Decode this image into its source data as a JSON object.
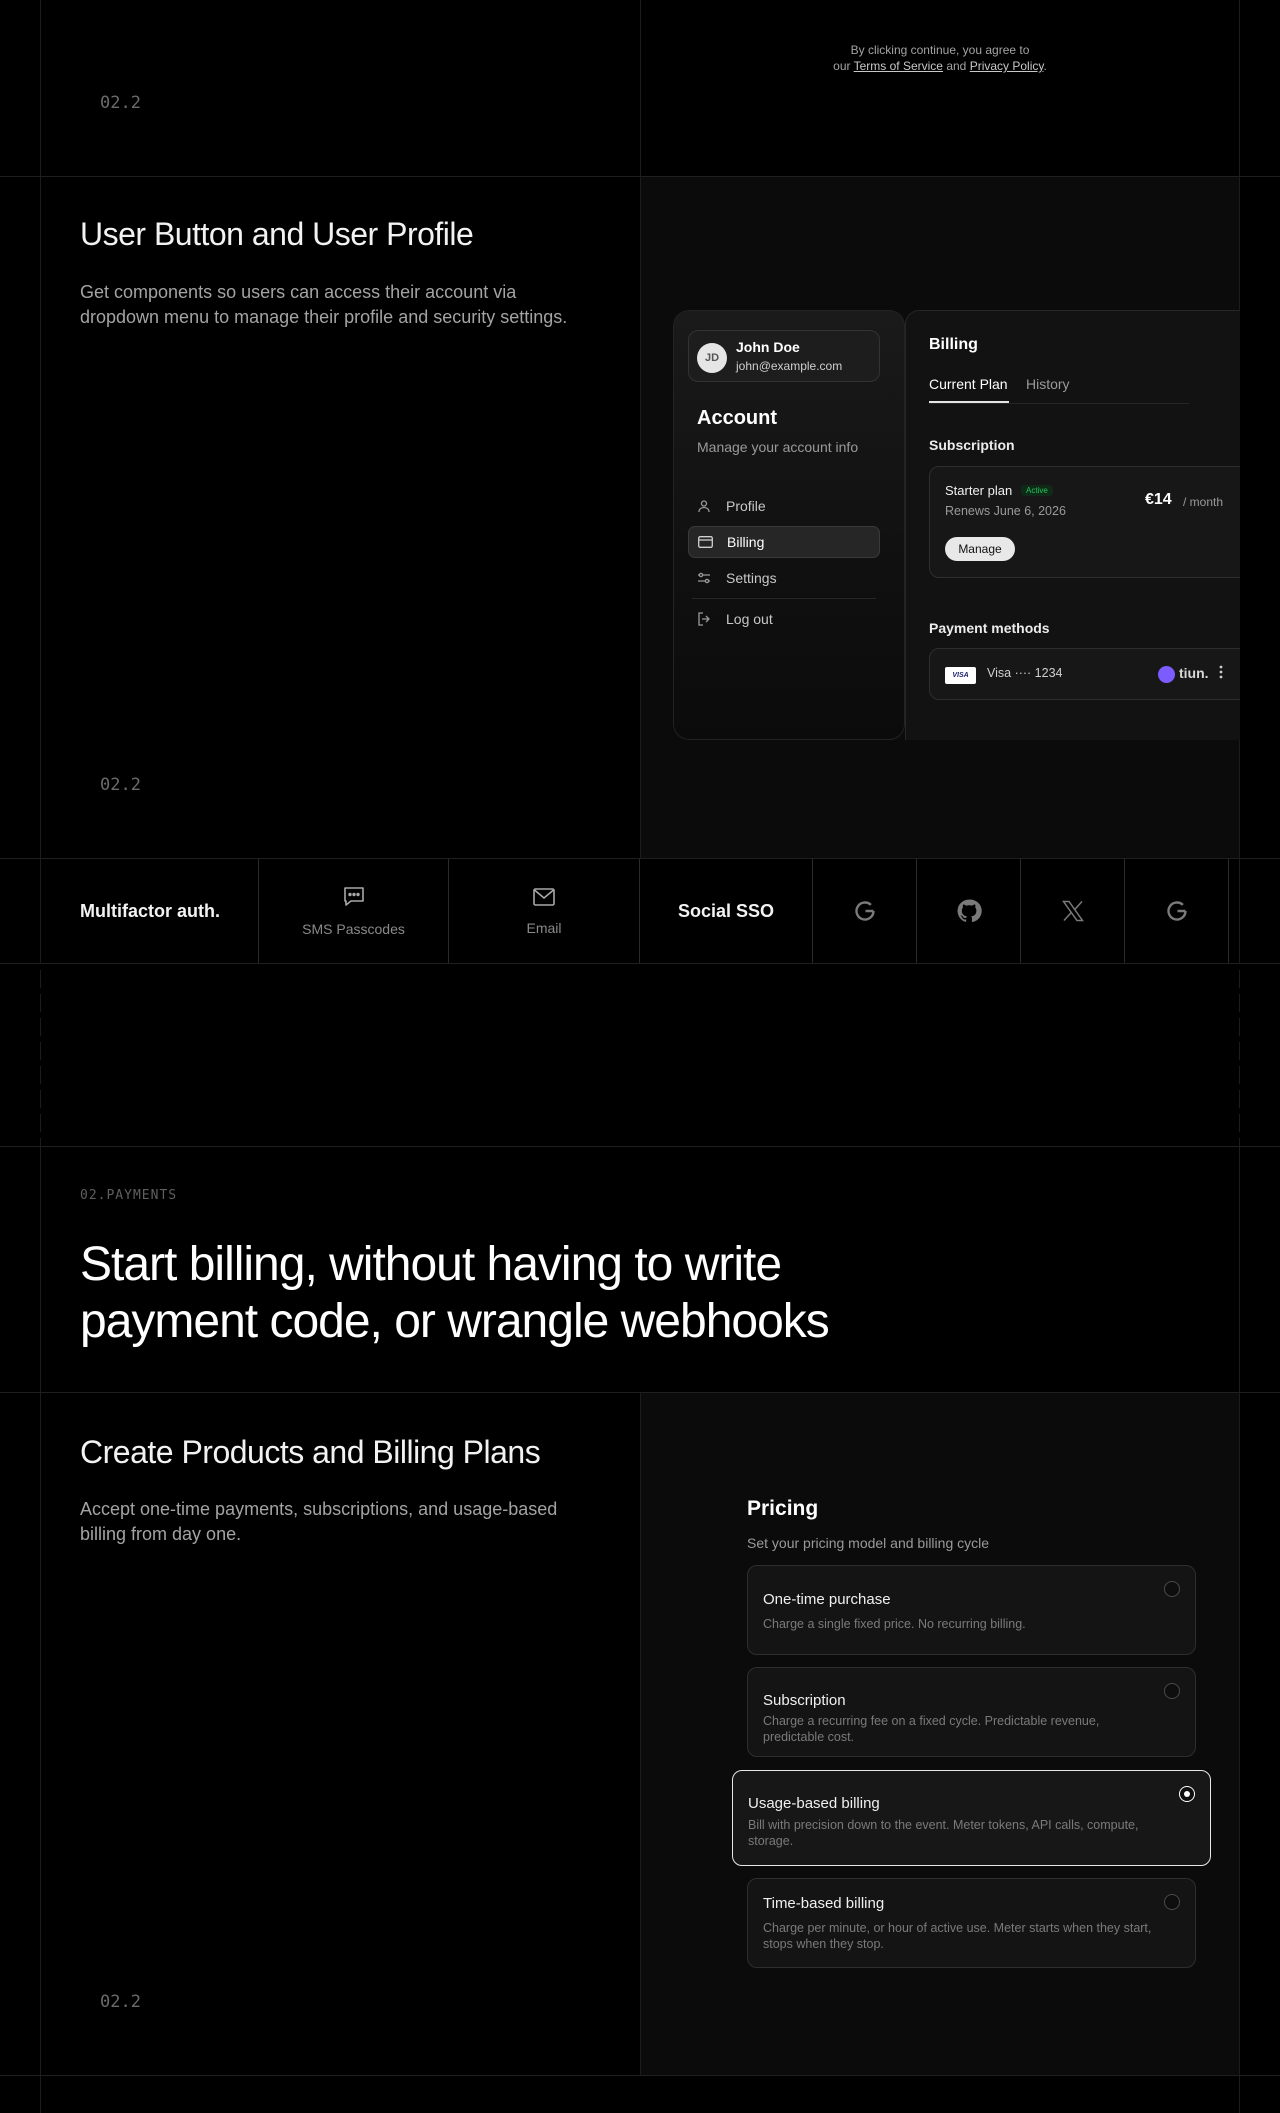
{
  "section_top": {
    "tos_line1": "By clicking continue, you agree to",
    "tos_our": "our",
    "tos_terms": "Terms of Service",
    "tos_and": "and",
    "tos_privacy": "Privacy Policy",
    "tos_end": ".",
    "index": "02.2"
  },
  "user_profile": {
    "title": "User Button and User Profile",
    "description": "Get components so users can access their account via dropdown menu to manage their profile and security settings.",
    "index": "02.2",
    "card": {
      "user": {
        "initials": "JD",
        "name": "John Doe",
        "email": "john@example.com"
      },
      "account_title": "Account",
      "account_subtitle": "Manage your account info",
      "menu": [
        {
          "label": "Profile",
          "icon": "user-icon"
        },
        {
          "label": "Billing",
          "icon": "credit-card-icon",
          "active": true
        },
        {
          "label": "Settings",
          "icon": "sliders-icon"
        },
        {
          "label": "Log out",
          "icon": "log-out-icon"
        }
      ],
      "billing": {
        "title": "Billing",
        "tabs": [
          "Current Plan",
          "History"
        ],
        "subscription_heading": "Subscription",
        "plan_name": "Starter plan",
        "plan_badge": "Active",
        "plan_renews": "Renews June 6, 2026",
        "price": "€14",
        "period": "/ month",
        "manage_label": "Manage",
        "payment_heading": "Payment methods",
        "card_brand": "VISA",
        "card_text": "Visa ···· 1234",
        "provider": "tiun."
      }
    }
  },
  "mfa_strip": {
    "mfa_title": "Multifactor auth.",
    "sms_label": "SMS Passcodes",
    "email_label": "Email",
    "sso_title": "Social SSO"
  },
  "payments": {
    "eyebrow": "02.PAYMENTS",
    "headline_line1": "Start billing, without having to write",
    "headline_line2": "payment code, or wrangle webhooks"
  },
  "products": {
    "title": "Create Products and Billing Plans",
    "description": "Accept one-time payments, subscriptions, and usage-based billing from day one.",
    "index": "02.2",
    "pricing": {
      "title": "Pricing",
      "subtitle": "Set your pricing model and billing cycle",
      "options": [
        {
          "title": "One-time purchase",
          "desc": "Charge a single fixed price. No recurring billing.",
          "selected": false
        },
        {
          "title": "Subscription",
          "desc": "Charge a recurring fee on a fixed cycle. Predictable revenue, predictable cost.",
          "selected": false
        },
        {
          "title": "Usage-based billing",
          "desc": "Bill with precision down to the event. Meter tokens, API calls, compute, storage.",
          "selected": true
        },
        {
          "title": "Time-based billing",
          "desc": "Charge per minute, or hour of active use. Meter starts when they start, stops when they stop.",
          "selected": false
        }
      ]
    }
  },
  "colors": {
    "background": "#000000",
    "panel": "#0b0b0b",
    "active_badge": "#22c55e",
    "tiun_purple": "#7c5cff"
  }
}
